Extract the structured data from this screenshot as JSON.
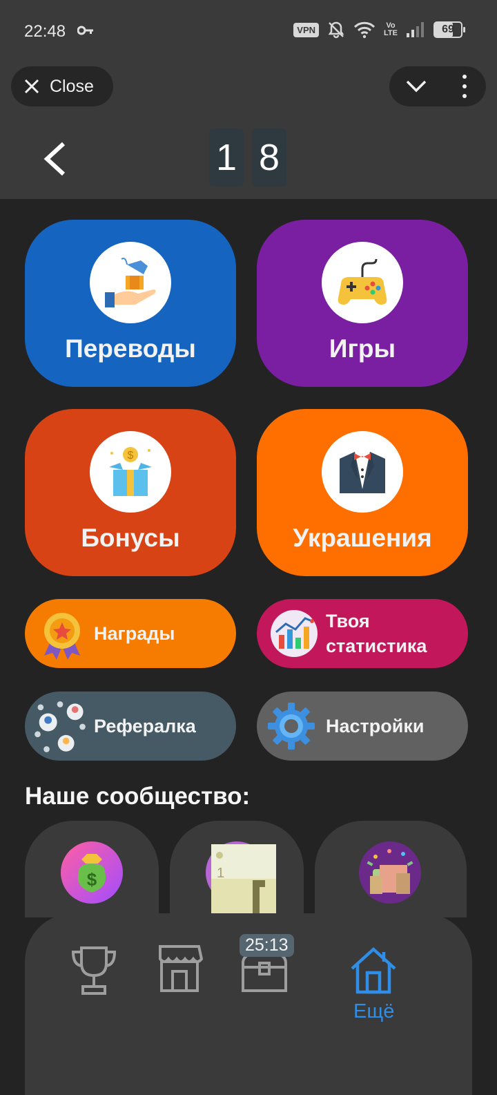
{
  "status_bar": {
    "time": "22:48",
    "vpn": "VPN",
    "volte_top": "Vo",
    "volte_bottom": "LTE",
    "battery": "69",
    "battery_level": 0.69
  },
  "top_bar": {
    "close_label": "Close",
    "counter_digits": [
      "1",
      "8"
    ]
  },
  "tiles": [
    {
      "label": "Переводы",
      "color": "#1565c0",
      "icon": "money-transfer-icon"
    },
    {
      "label": "Игры",
      "color": "#7b1fa2",
      "icon": "gamepad-icon"
    },
    {
      "label": "Бонусы",
      "color": "#d84315",
      "icon": "gift-box-icon"
    },
    {
      "label": "Украшения",
      "color": "#ff6f00",
      "icon": "tuxedo-icon"
    }
  ],
  "pills": [
    {
      "label": "Награды",
      "color": "#f57c00",
      "icon": "medal-icon"
    },
    {
      "label": "Твоя статистика",
      "color": "#c2185b",
      "icon": "chart-icon"
    },
    {
      "label": "Рефералка",
      "color": "#455a64",
      "icon": "referral-network-icon"
    },
    {
      "label": "Настройки",
      "color": "#616161",
      "icon": "gear-icon"
    }
  ],
  "community": {
    "title": "Наше сообщество:",
    "items": [
      "money-bag-icon",
      "sticker-icon",
      "money-party-icon"
    ]
  },
  "bottom_nav": {
    "items": [
      {
        "icon": "trophy-icon",
        "active": false
      },
      {
        "icon": "shop-icon",
        "active": false
      },
      {
        "icon": "chest-icon",
        "active": false,
        "timer": "25:13"
      },
      {
        "icon": "home-icon",
        "active": true,
        "label": "Ещё"
      }
    ],
    "active_color": "#2f8ee8"
  }
}
